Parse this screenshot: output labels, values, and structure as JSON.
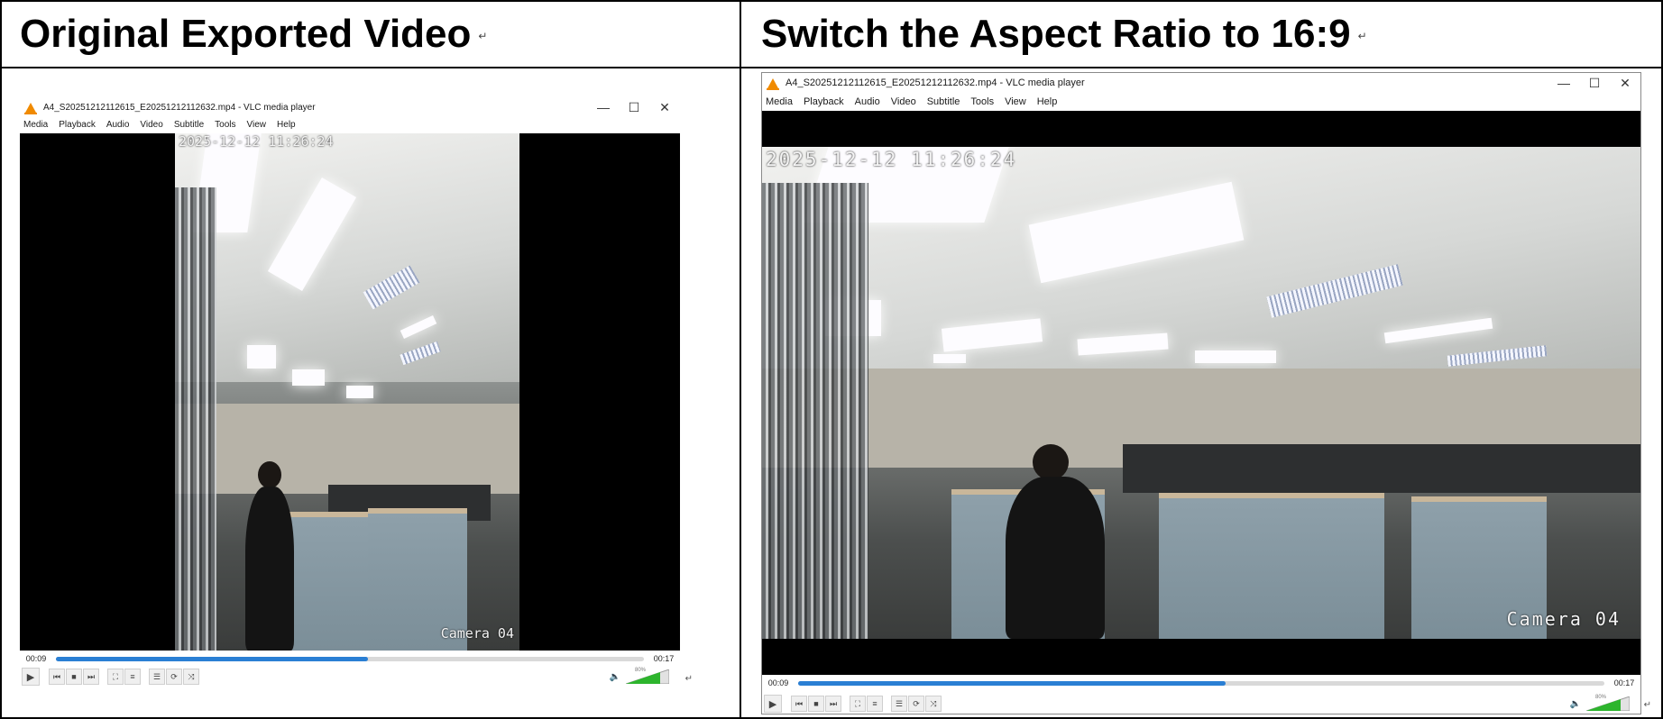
{
  "panels": {
    "left": {
      "heading": "Original Exported Video",
      "heading_mark": "↵",
      "window": {
        "title": "A4_S20251212112615_E20251212112632.mp4 - VLC media player",
        "menu": [
          "Media",
          "Playback",
          "Audio",
          "Video",
          "Subtitle",
          "Tools",
          "View",
          "Help"
        ],
        "timestamp_overlay": "2025-12-12 11:26:24",
        "camera_label": "Camera 04",
        "elapsed": "00:09",
        "duration": "00:17",
        "progress_fraction": 0.53,
        "volume_label": "80%",
        "return_mark": "↵"
      }
    },
    "right": {
      "heading": "Switch the Aspect Ratio to 16:9",
      "heading_mark": "↵",
      "window": {
        "title": "A4_S20251212112615_E20251212112632.mp4 - VLC media player",
        "menu": [
          "Media",
          "Playback",
          "Audio",
          "Video",
          "Subtitle",
          "Tools",
          "View",
          "Help"
        ],
        "timestamp_overlay": "2025-12-12 11:26:24",
        "camera_label": "Camera 04",
        "elapsed": "00:09",
        "duration": "00:17",
        "progress_fraction": 0.53,
        "volume_label": "80%",
        "return_mark": "↵"
      }
    }
  },
  "window_controls": {
    "minimize": "—",
    "maximize": "☐",
    "close": "✕"
  },
  "player_icons": {
    "play": "▶",
    "prev": "⏮",
    "stop": "■",
    "next": "⏭",
    "fullscreen": "⛶",
    "extended": "≡",
    "playlist": "☰",
    "loop": "⟳",
    "shuffle": "⤨",
    "speaker": "🔈"
  },
  "colors": {
    "progress": "#2a7fd4",
    "volume": "#2db52d",
    "vlc_cone": "#f08a00"
  }
}
